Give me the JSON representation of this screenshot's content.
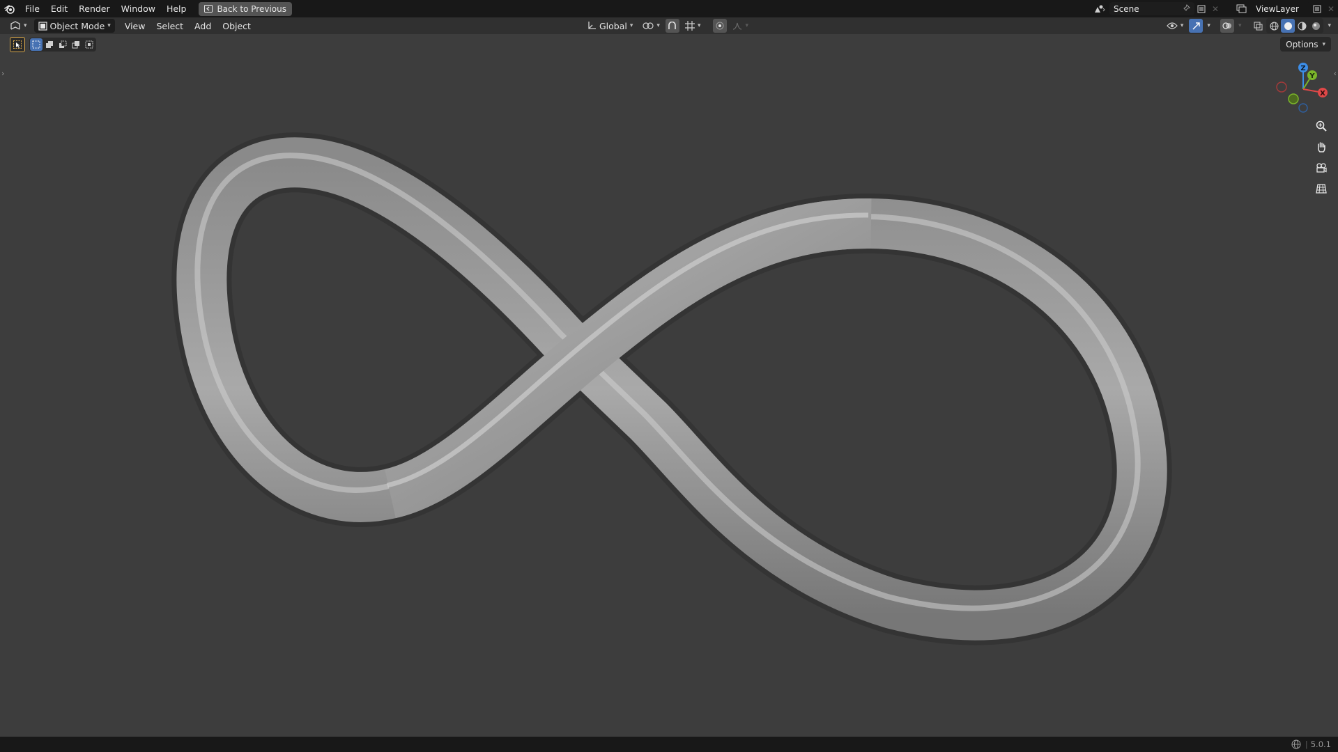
{
  "topbar": {
    "menus": [
      "File",
      "Edit",
      "Render",
      "Window",
      "Help"
    ],
    "back_button": "Back to Previous",
    "scene_name": "Scene",
    "view_layer_name": "ViewLayer"
  },
  "header": {
    "mode": "Object Mode",
    "menus": [
      "View",
      "Select",
      "Add",
      "Object"
    ],
    "orientation": "Global"
  },
  "viewport": {
    "options_label": "Options",
    "gizmo": {
      "x": "X",
      "y": "Y",
      "z": "Z"
    },
    "object": "infinity-loop-mesh"
  },
  "statusbar": {
    "version": "5.0.1"
  },
  "colors": {
    "topbar_bg": "#181818",
    "header_bg": "#303030",
    "viewport_bg": "#3d3d3d",
    "accent": "#4772b3",
    "axis_x": "#e04848",
    "axis_y": "#7bb52a",
    "axis_z": "#3d8ee8"
  },
  "icons": [
    "blender-logo-icon",
    "back-icon",
    "scene-icon",
    "pin-icon",
    "new-icon",
    "close-icon",
    "viewlayer-icon",
    "editor-type-icon",
    "object-mode-icon",
    "transform-orientation-icon",
    "pivot-icon",
    "snap-icon",
    "proportional-icon",
    "visibility-icon",
    "gizmo-icon",
    "overlay-icon",
    "xray-icon",
    "wireframe-shading-icon",
    "solid-shading-icon",
    "material-shading-icon",
    "rendered-shading-icon",
    "select-tool-icon",
    "zoom-icon",
    "pan-hand-icon",
    "camera-icon",
    "grid-view-icon",
    "globe-icon"
  ]
}
